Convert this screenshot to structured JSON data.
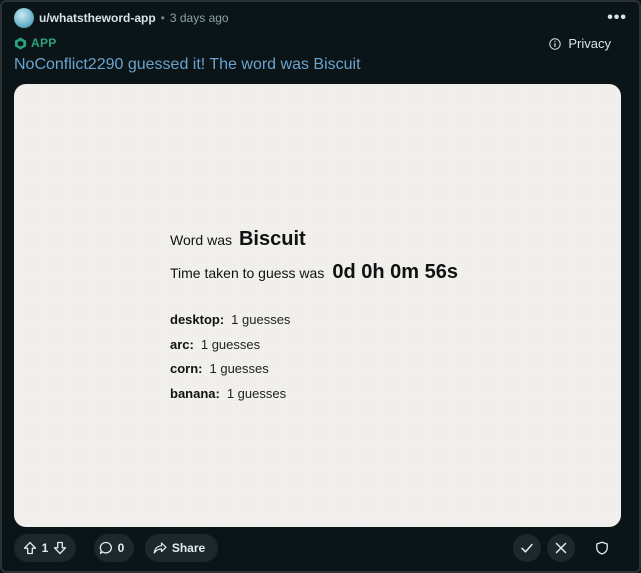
{
  "post": {
    "username": "u/whatstheword-app",
    "separator": "•",
    "time": "3 days ago",
    "app_label": "APP",
    "privacy_label": "Privacy",
    "title": "NoConflict2290 guessed it! The word was Biscuit"
  },
  "game": {
    "word_label": "Word was",
    "word": "Biscuit",
    "time_label": "Time taken to guess was",
    "time_value": "0d 0h 0m 56s",
    "players": [
      {
        "name": "desktop:",
        "guesses": "1 guesses"
      },
      {
        "name": "arc:",
        "guesses": "1 guesses"
      },
      {
        "name": "corn:",
        "guesses": "1 guesses"
      },
      {
        "name": "banana:",
        "guesses": "1 guesses"
      }
    ]
  },
  "actions": {
    "vote_count": "1",
    "comment_count": "0",
    "share_label": "Share"
  },
  "icons": {
    "more": "more-horizontal-icon",
    "app": "app-hexagon-icon",
    "privacy": "info-icon",
    "upvote": "upvote-arrow-icon",
    "downvote": "downvote-arrow-icon",
    "comment": "comment-bubble-icon",
    "share": "share-arrow-icon",
    "approve": "checkmark-icon",
    "remove": "x-icon",
    "mod": "shield-icon"
  },
  "colors": {
    "background": "#0b1416",
    "accent_title": "#6ba3cf",
    "app_badge": "#2ba37f",
    "card": "#f2f1ee"
  }
}
